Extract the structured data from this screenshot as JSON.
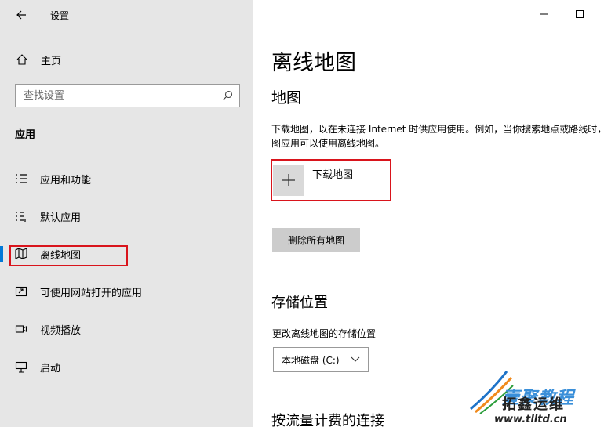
{
  "window": {
    "title": "设置"
  },
  "sidebar": {
    "home_label": "主页",
    "search_placeholder": "查找设置",
    "section_header": "应用",
    "items": [
      {
        "label": "应用和功能",
        "icon": "list-icon"
      },
      {
        "label": "默认应用",
        "icon": "default-apps-icon"
      },
      {
        "label": "离线地图",
        "icon": "map-icon",
        "active": true
      },
      {
        "label": "可使用网站打开的应用",
        "icon": "open-in-app-icon"
      },
      {
        "label": "视频播放",
        "icon": "video-icon"
      },
      {
        "label": "启动",
        "icon": "startup-icon"
      }
    ]
  },
  "main": {
    "title": "离线地图",
    "section_title": "地图",
    "description": "下载地图，以在未连接 Internet 时供应用使用。例如，当你搜索地点或路线时，地图应用可以使用离线地图。",
    "download_label": "下载地图",
    "delete_all_label": "删除所有地图",
    "storage_title": "存储位置",
    "storage_label": "更改离线地图的存储位置",
    "storage_value": "本地磁盘 (C:)",
    "metered_title": "按流量计费的连接"
  },
  "watermark": {
    "line1": "壹聚教程",
    "line2": "拓鑫运维",
    "line3": "www.tlltd.cn"
  },
  "colors": {
    "accent": "#0078d7",
    "highlight_box": "#d9141c",
    "sidebar_bg": "#e6e6e6"
  }
}
